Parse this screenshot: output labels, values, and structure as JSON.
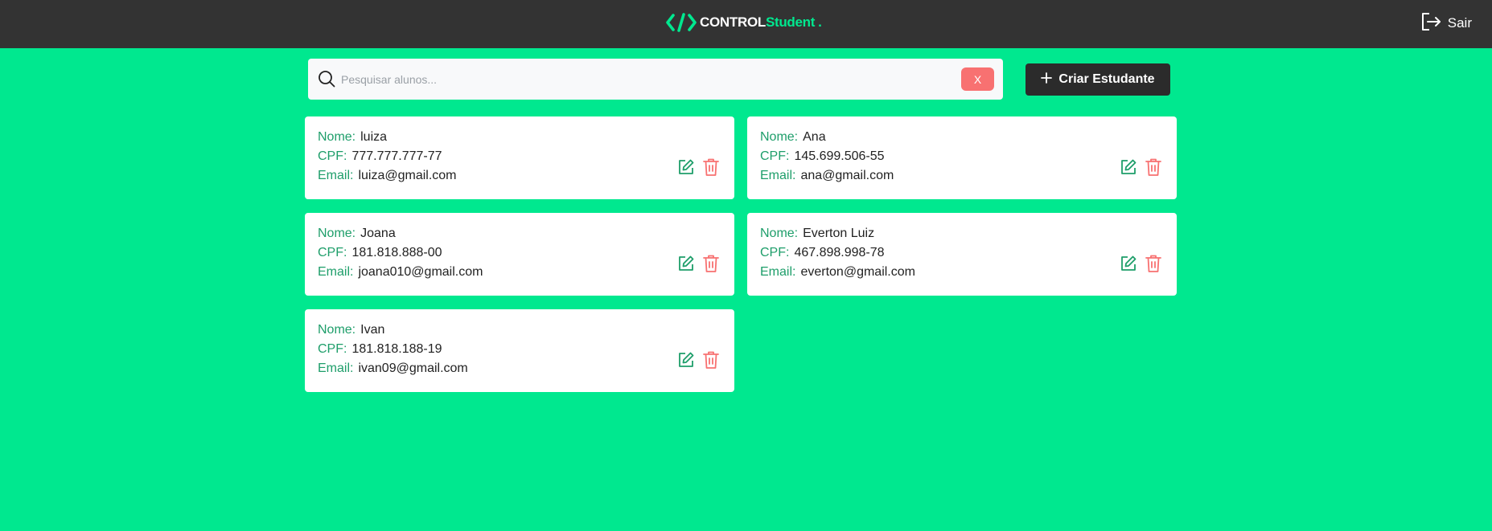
{
  "header": {
    "logo_control": "CONTROL",
    "logo_student": "Student",
    "logo_dot": ".",
    "logout_label": "Sair"
  },
  "search": {
    "placeholder": "Pesquisar alunos...",
    "value": "",
    "clear_label": "X"
  },
  "create_button_label": "Criar Estudante",
  "labels": {
    "name": "Nome:",
    "cpf": "CPF:",
    "email": "Email:"
  },
  "students": [
    {
      "name": "luiza",
      "cpf": "777.777.777-77",
      "email": "luiza@gmail.com"
    },
    {
      "name": "Ana",
      "cpf": "145.699.506-55",
      "email": "ana@gmail.com"
    },
    {
      "name": "Joana",
      "cpf": "181.818.888-00",
      "email": "joana010@gmail.com"
    },
    {
      "name": "Everton Luiz",
      "cpf": "467.898.998-78",
      "email": "everton@gmail.com"
    },
    {
      "name": "Ivan",
      "cpf": "181.818.188-19",
      "email": "ivan09@gmail.com"
    }
  ],
  "icons": {
    "logo": "code-icon",
    "logout": "logout-icon",
    "search": "search-icon",
    "create": "plus-icon",
    "edit": "edit-icon",
    "delete": "trash-icon"
  },
  "colors": {
    "background": "#00e88f",
    "header": "#333333",
    "accent": "#00e88f",
    "label": "#1e9e6a",
    "delete": "#f87171",
    "create_button": "#2b2b2b"
  }
}
